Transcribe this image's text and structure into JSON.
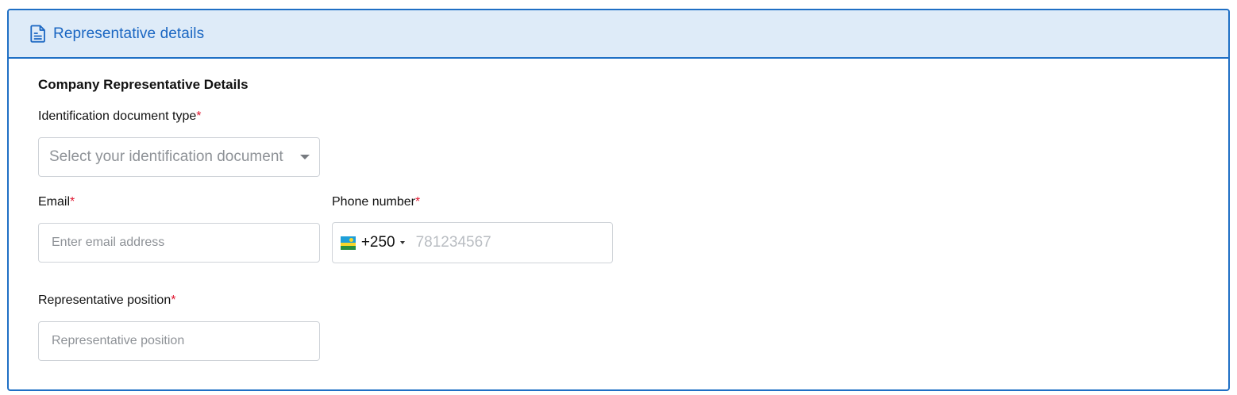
{
  "header": {
    "icon": "document-icon",
    "title": "Representative details"
  },
  "section": {
    "title": "Company Representative Details"
  },
  "fields": {
    "id_doc_type": {
      "label": "Identification document type",
      "required_mark": "*",
      "placeholder": "Select your identification document"
    },
    "email": {
      "label": "Email",
      "required_mark": "*",
      "placeholder": "Enter email address",
      "value": ""
    },
    "phone": {
      "label": "Phone number",
      "required_mark": "*",
      "country_flag": "rwanda-flag-icon",
      "dial_code": "+250",
      "placeholder": "781234567",
      "value": ""
    },
    "position": {
      "label": "Representative position",
      "required_mark": "*",
      "placeholder": "Representative position",
      "value": ""
    }
  },
  "colors": {
    "accent": "#1f6fc5",
    "header_bg": "#deebf8",
    "required": "#e0142e"
  }
}
